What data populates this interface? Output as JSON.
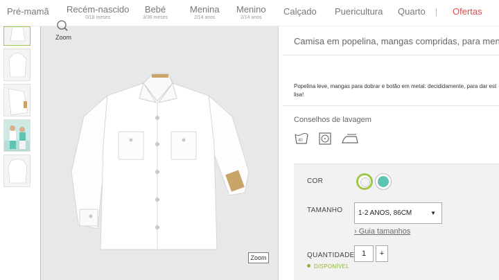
{
  "nav": {
    "items": [
      {
        "label": "Pré-mamã",
        "sub": ""
      },
      {
        "label": "Recém-nascido",
        "sub": "0/18 meses"
      },
      {
        "label": "Bebé",
        "sub": "3/36 meses"
      },
      {
        "label": "Menina",
        "sub": "2/14 anos"
      },
      {
        "label": "Menino",
        "sub": "2/14 anos"
      },
      {
        "label": "Calçado",
        "sub": ""
      },
      {
        "label": "Puericultura",
        "sub": ""
      },
      {
        "label": "Quarto",
        "sub": ""
      },
      {
        "label": "Ofertas",
        "sub": ""
      }
    ],
    "offers_color": "#e24a4a"
  },
  "gallery": {
    "zoom_label": "Zoom",
    "zoom_button": "Zoom"
  },
  "product": {
    "title": "Camisa em popelina, mangas compridas, para menino",
    "description": "Popelina leve, mangas para dobrar e botão em metal: decididamente, para dar est lisa!",
    "wash_title": "Conselhos de lavagem",
    "wash_icons": [
      "wash-40-icon",
      "tumble-dry-icon",
      "iron-icon"
    ]
  },
  "options": {
    "color_label": "COR",
    "colors": [
      "#f4f4f4",
      "#5ec5b2"
    ],
    "selected_accent": "#9fc84a",
    "size_label": "TAMANHO",
    "size_value": "1-2 ANOS, 86CM",
    "size_guide": "› Guia tamanhos",
    "qty_label": "QUANTIDADE",
    "qty_value": "1",
    "qty_plus": "+",
    "availability": "DISPONÍVEL"
  }
}
